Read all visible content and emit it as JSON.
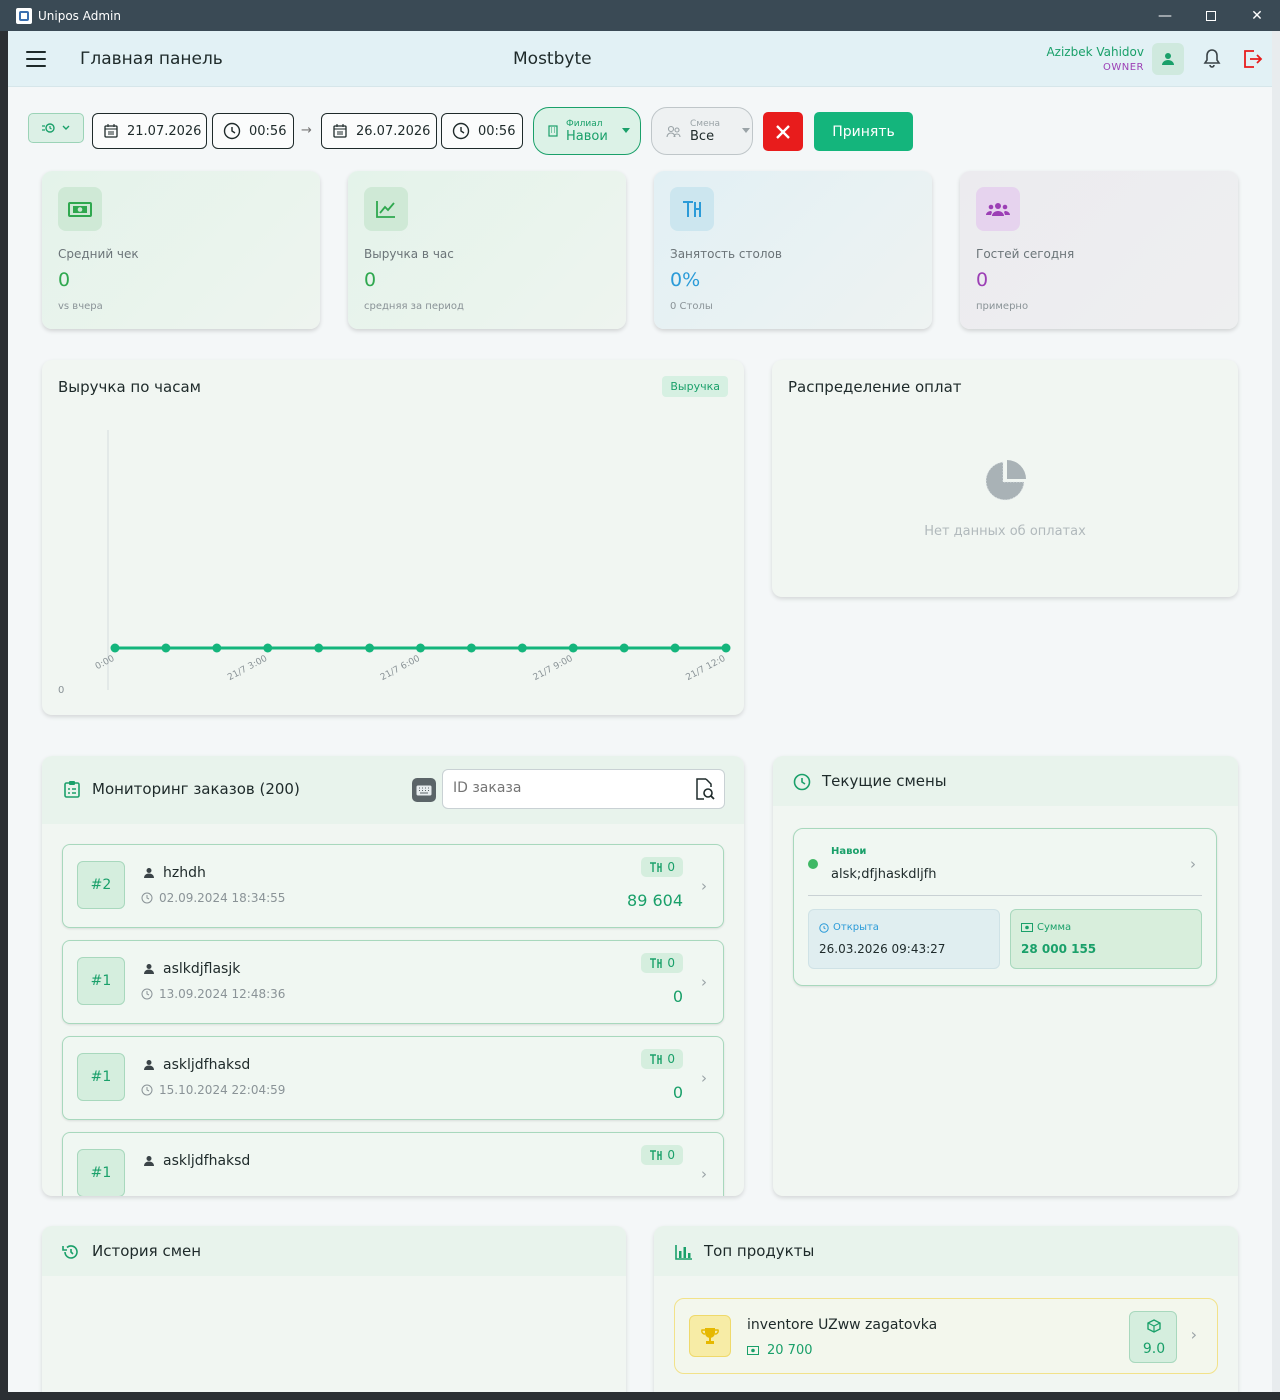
{
  "window": {
    "title": "Unipos Admin"
  },
  "header": {
    "page_title": "Главная панель",
    "brand": "Mostbyte",
    "user_name": "Azizbek Vahidov",
    "user_role": "OWNER"
  },
  "filters": {
    "date_from": "21.07.2026",
    "time_from": "00:56",
    "date_to": "26.07.2026",
    "time_to": "00:56",
    "branch_label": "Филиал",
    "branch_value": "Навои",
    "shift_label": "Смена",
    "shift_value": "Все",
    "accept_label": "Принять"
  },
  "stats": [
    {
      "label": "Средний чек",
      "value": "0",
      "sub": "vs вчера",
      "icon": "money-icon",
      "color": "#2fa84f"
    },
    {
      "label": "Выручка в час",
      "value": "0",
      "sub": "средняя за период",
      "icon": "trend-icon",
      "color": "#2fa84f"
    },
    {
      "label": "Занятость столов",
      "value": "0%",
      "sub": "0 Столы",
      "icon": "table-icon",
      "color": "#2b9bd8"
    },
    {
      "label": "Гостей сегодня",
      "value": "0",
      "sub": "примерно",
      "icon": "group-icon",
      "color": "#9c3fb5"
    }
  ],
  "revenue_chart": {
    "title": "Выручка по часам",
    "badge": "Выручка"
  },
  "chart_data": {
    "type": "line",
    "x": [
      "21/7 0:00",
      "21/7 1:00",
      "21/7 2:00",
      "21/7 3:00",
      "21/7 4:00",
      "21/7 5:00",
      "21/7 6:00",
      "21/7 7:00",
      "21/7 8:00",
      "21/7 9:00",
      "21/7 10:00",
      "21/7 11:00",
      "21/7 12:00"
    ],
    "tick_labels": [
      "0:00",
      "21/7 3:00",
      "21/7 6:00",
      "21/7 9:00",
      "21/7 12:0"
    ],
    "values": [
      0,
      0,
      0,
      0,
      0,
      0,
      0,
      0,
      0,
      0,
      0,
      0,
      0
    ],
    "y_tick": "0",
    "color": "#14b57c"
  },
  "payments": {
    "title": "Распределение оплат",
    "empty_text": "Нет данных об оплатах"
  },
  "orders": {
    "title": "Мониторинг заказов (200)",
    "search_placeholder": "ID заказа",
    "items": [
      {
        "num": "#2",
        "user": "hzhdh",
        "time": "02.09.2024 18:34:55",
        "table": "0",
        "sum": "89 604"
      },
      {
        "num": "#1",
        "user": "aslkdjflasjk",
        "time": "13.09.2024 12:48:36",
        "table": "0",
        "sum": "0"
      },
      {
        "num": "#1",
        "user": "askljdfhaksd",
        "time": "15.10.2024 22:04:59",
        "table": "0",
        "sum": "0"
      },
      {
        "num": "#1",
        "user": "askljdfhaksd",
        "time": "",
        "table": "0",
        "sum": ""
      }
    ]
  },
  "current_shifts": {
    "title": "Текущие смены",
    "branch": "Навои",
    "name": "alsk;dfjhaskdljfh",
    "opened_label": "Открыта",
    "opened_value": "26.03.2026 09:43:27",
    "sum_label": "Сумма",
    "sum_value": "28 000 155"
  },
  "shift_history": {
    "title": "История смен"
  },
  "top_products": {
    "title": "Топ продукты",
    "items": [
      {
        "name": "inventore UZww zagatovka",
        "price": "20 700",
        "qty": "9.0"
      }
    ]
  }
}
